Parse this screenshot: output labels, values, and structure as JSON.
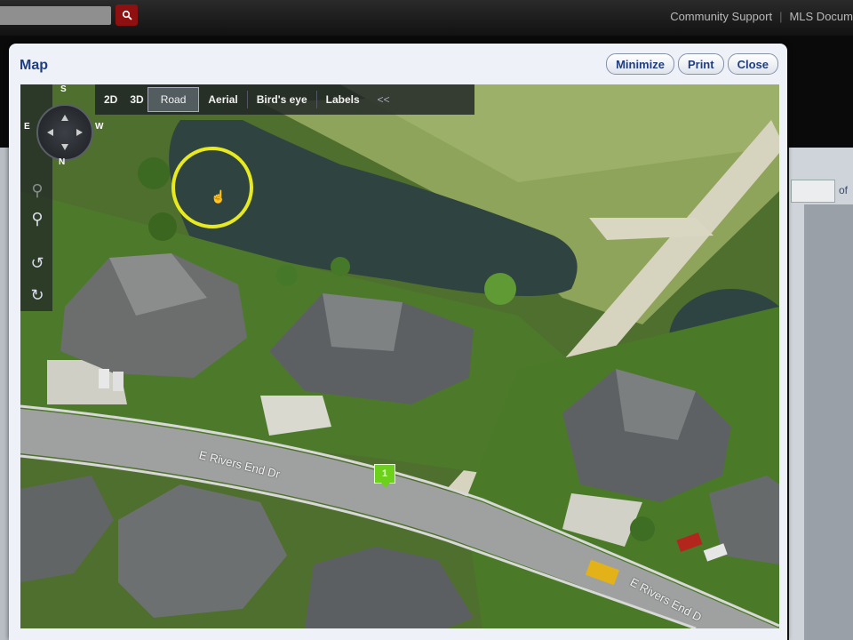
{
  "header": {
    "links": [
      "Community Support",
      "MLS Docum"
    ]
  },
  "background": {
    "of_label": "of"
  },
  "dialog": {
    "title": "Map",
    "buttons": {
      "minimize": "Minimize",
      "print": "Print",
      "close": "Close"
    }
  },
  "map_toolbar": {
    "items": [
      "2D",
      "3D",
      "Road",
      "Aerial",
      "Bird's eye",
      "Labels",
      "<<"
    ],
    "active": "Road"
  },
  "compass": {
    "n": "N",
    "s": "S",
    "e": "E",
    "w": "W"
  },
  "map_labels": {
    "street_1": "E Rivers End Dr",
    "street_2": "E Rivers End D",
    "pin": "1"
  },
  "icons": {
    "search": "search-icon",
    "zoom_out": "zoom-out-icon",
    "zoom_in": "zoom-in-icon",
    "rotate_left": "rotate-left-icon",
    "rotate_right": "rotate-right-icon",
    "cursor": "hand-cursor-icon"
  },
  "colors": {
    "highlight": "#e8ea1f",
    "pin": "#6bd11b",
    "title": "#1f3e80",
    "search_button": "#8e1010"
  }
}
